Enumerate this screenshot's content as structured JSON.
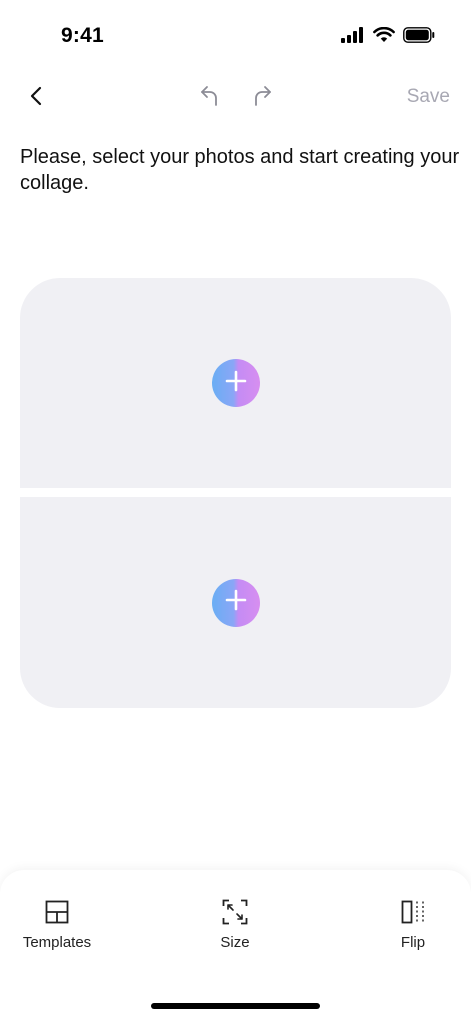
{
  "status_bar": {
    "time": "9:41",
    "icons": [
      "cellular-signal-icon",
      "wifi-icon",
      "battery-icon"
    ]
  },
  "nav": {
    "back_icon": "chevron-left-icon",
    "undo_icon": "undo-arrow-icon",
    "redo_icon": "redo-arrow-icon",
    "save_label": "Save"
  },
  "instruction": "Please, select your photos and start creating your collage.",
  "collage": {
    "cells": [
      {
        "add_icon": "plus-icon"
      },
      {
        "add_icon": "plus-icon"
      }
    ]
  },
  "toolbar": {
    "items": [
      {
        "label": "Templates",
        "icon": "templates-grid-icon"
      },
      {
        "label": "Size",
        "icon": "resize-frame-icon"
      },
      {
        "label": "Flip",
        "icon": "flip-icon"
      }
    ]
  },
  "colors": {
    "save_disabled": "#a8a8b3",
    "cell_background": "#f0f0f4",
    "gradient_start": "#6aaef4",
    "gradient_end": "#d78ef0"
  }
}
